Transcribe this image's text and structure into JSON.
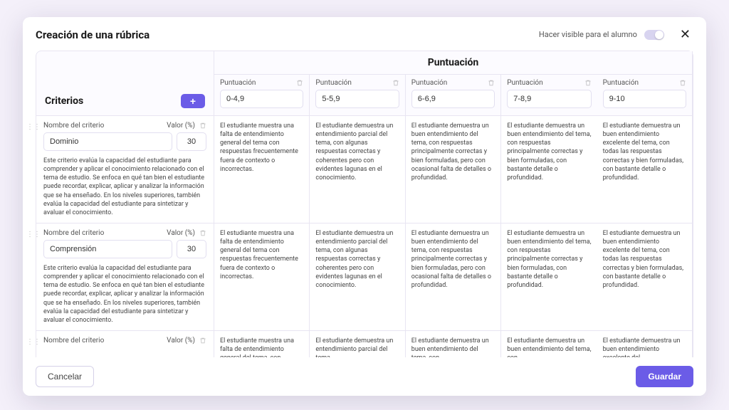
{
  "modal": {
    "title": "Creación de una rúbrica",
    "visibility_label": "Hacer visible para el alumno",
    "cancel": "Cancelar",
    "save": "Guardar"
  },
  "headers": {
    "puntuacion": "Puntuación",
    "criterios": "Criterios",
    "nombre_criterio": "Nombre del criterio",
    "valor": "Valor (%)"
  },
  "scores": [
    {
      "label": "Puntuación",
      "range": "0-4,9"
    },
    {
      "label": "Puntuación",
      "range": "5-5,9"
    },
    {
      "label": "Puntuación",
      "range": "6-6,9"
    },
    {
      "label": "Puntuación",
      "range": "7-8,9"
    },
    {
      "label": "Puntuación",
      "range": "9-10"
    }
  ],
  "criteria": [
    {
      "name": "Dominio",
      "value": "30",
      "description": "Este criterio evalúa la capacidad del estudiante para comprender y aplicar el conocimiento relacionado con el tema de estudio. Se enfoca en qué tan bien el estudiante puede recordar, explicar, aplicar y analizar la información que se ha enseñado. En los niveles superiores, también evalúa la capacidad del estudiante para sintetizar y avaluar el conocimiento.",
      "cells": [
        "El estudiante muestra una falta de entendimiento general del tema con respuestas frecuentemente fuera de contexto o incorrectas.",
        "El estudiante demuestra un entendimiento parcial del tema, con algunas respuestas correctas y coherentes pero con evidentes lagunas en el conocimiento.",
        "El estudiante demuestra un buen entendimiento del tema, con respuestas principalmente correctas y bien formuladas, pero con ocasional falta de detalles o profundidad.",
        "El estudiante demuestra un buen entendimiento del tema, con respuestas principalmente correctas y bien formuladas, con bastante detalle o profundidad.",
        "El estudiante demuestra un buen entendimiento excelente del tema, con todas las respuestas correctas y bien formuladas, con bastante detalle o profundidad."
      ]
    },
    {
      "name": "Comprensión",
      "value": "30",
      "description": "Este criterio evalúa la capacidad del estudiante para comprender y aplicar el conocimiento relacionado con el tema de estudio. Se enfoca en qué tan bien el estudiante puede recordar, explicar, aplicar y analizar la información que se ha enseñado. En los niveles superiores, también evalúa la capacidad del estudiante para sintetizar y avaluar el conocimiento.",
      "cells": [
        "El estudiante muestra una falta de entendimiento general del tema con respuestas frecuentemente fuera de contexto o incorrectas.",
        "El estudiante demuestra un entendimiento parcial del tema, con algunas respuestas correctas y coherentes pero con evidentes lagunas en el conocimiento.",
        "El estudiante demuestra un buen entendimiento del tema, con respuestas principalmente correctas y bien formuladas, pero con ocasional falta de detalles o profundidad.",
        "El estudiante demuestra un buen entendimiento del tema, con respuestas principalmente correctas y bien formuladas, con bastante detalle o profundidad.",
        "El estudiante demuestra un buen entendimiento excelente del tema, con todas las respuestas correctas y bien formuladas, con bastante detalle o profundidad."
      ]
    },
    {
      "name": "",
      "value": "",
      "description": "",
      "cells": [
        "El estudiante muestra una falta de entendimiento general del tema, con",
        "El estudiante demuestra un entendimiento parcial del tema,",
        "El estudiante demuestra un buen entendimiento del tema, con",
        "El estudiante demuestra un buen entendimiento del tema, con",
        "El estudiante demuestra un buen entendimiento excelente del"
      ]
    }
  ]
}
